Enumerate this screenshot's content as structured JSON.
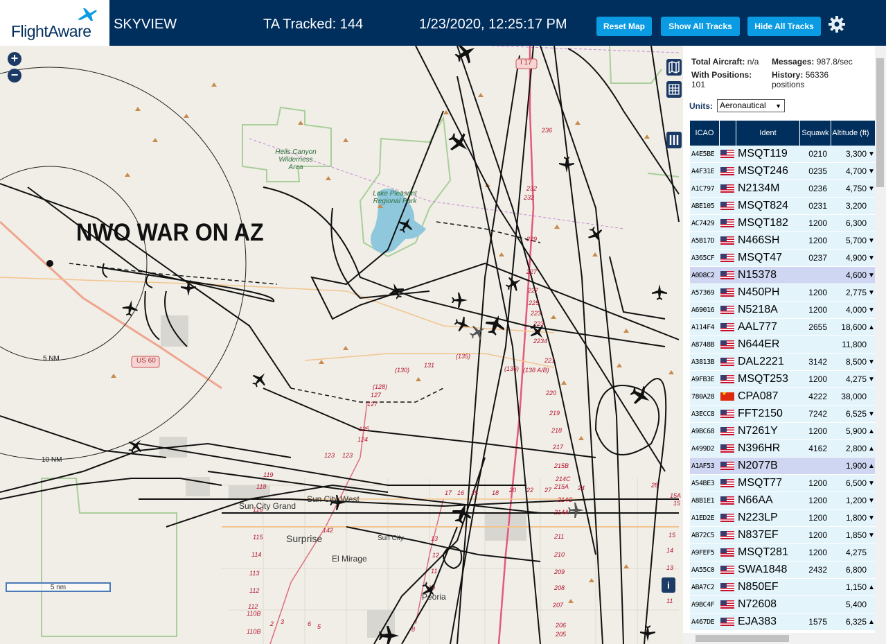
{
  "header": {
    "logo_text": "FlightAware",
    "app_name": "SKYVIEW",
    "tracked": "TA Tracked: 144",
    "datetime": "1/23/2020, 12:25:17 PM",
    "buttons": {
      "reset": "Reset Map",
      "show": "Show All Tracks",
      "hide": "Hide All Tracks"
    }
  },
  "map": {
    "overlay_text": "NWO WAR ON AZ",
    "zoom_in": "+",
    "zoom_out": "−",
    "labels": {
      "hells_canyon": "Hells Canyon Wilderness Area",
      "lake": "Lake Pleasant Regional Park",
      "sun_city_grand": "Sun City Grand",
      "sun_city_west": "Sun City West",
      "sun_city": "Sun City",
      "surprise": "Surprise",
      "el_mirage": "El Mirage",
      "peoria": "Peoria",
      "us60": "US 60",
      "i17": "I 17",
      "ring5": "5 NM",
      "ring10": "10 NM"
    },
    "scale": "5 nm",
    "info": "i"
  },
  "sidebar": {
    "stats": {
      "total_label": "Total Aircraft:",
      "total_value": "n/a",
      "messages_label": "Messages:",
      "messages_value": "987.8/sec",
      "positions_label": "With Positions:",
      "positions_value": "101",
      "history_label": "History:",
      "history_value": "56336 positions"
    },
    "units_label": "Units:",
    "units_value": "Aeronautical",
    "columns": {
      "icao": "ICAO",
      "ident": "Ident",
      "squawk": "Squawk",
      "altitude": "Altitude (ft)"
    },
    "rows": [
      {
        "icao": "A4E5BE",
        "flag": "us",
        "ident": "MSQT119",
        "squawk": "0210",
        "alt": "3,300",
        "arrow": "▼"
      },
      {
        "icao": "A4F31E",
        "flag": "us",
        "ident": "MSQT246",
        "squawk": "0235",
        "alt": "4,700",
        "arrow": "▼"
      },
      {
        "icao": "A1C797",
        "flag": "us",
        "ident": "N2134M",
        "squawk": "0236",
        "alt": "4,750",
        "arrow": "▼"
      },
      {
        "icao": "ABE105",
        "flag": "us",
        "ident": "MSQT824",
        "squawk": "0231",
        "alt": "3,200",
        "arrow": ""
      },
      {
        "icao": "AC7429",
        "flag": "us",
        "ident": "MSQT182",
        "squawk": "1200",
        "alt": "6,300",
        "arrow": ""
      },
      {
        "icao": "A5B17D",
        "flag": "us",
        "ident": "N466SH",
        "squawk": "1200",
        "alt": "5,700",
        "arrow": "▼"
      },
      {
        "icao": "A365CF",
        "flag": "us",
        "ident": "MSQT47",
        "squawk": "0237",
        "alt": "4,900",
        "arrow": "▼"
      },
      {
        "icao": "A0D8C2",
        "flag": "us",
        "ident": "N15378",
        "squawk": "",
        "alt": "4,600",
        "arrow": "▼",
        "sel": true
      },
      {
        "icao": "A57369",
        "flag": "us",
        "ident": "N450PH",
        "squawk": "1200",
        "alt": "2,775",
        "arrow": "▼"
      },
      {
        "icao": "A69016",
        "flag": "us",
        "ident": "N5218A",
        "squawk": "1200",
        "alt": "4,000",
        "arrow": "▼"
      },
      {
        "icao": "A114F4",
        "flag": "us",
        "ident": "AAL777",
        "squawk": "2655",
        "alt": "18,600",
        "arrow": "▲"
      },
      {
        "icao": "A8748B",
        "flag": "us",
        "ident": "N644ER",
        "squawk": "",
        "alt": "11,800",
        "arrow": ""
      },
      {
        "icao": "A3813B",
        "flag": "us",
        "ident": "DAL2221",
        "squawk": "3142",
        "alt": "8,500",
        "arrow": "▼"
      },
      {
        "icao": "A9FB3E",
        "flag": "us",
        "ident": "MSQT253",
        "squawk": "1200",
        "alt": "4,275",
        "arrow": "▼"
      },
      {
        "icao": "780A28",
        "flag": "cn",
        "ident": "CPA087",
        "squawk": "4222",
        "alt": "38,000",
        "arrow": ""
      },
      {
        "icao": "A3ECC8",
        "flag": "us",
        "ident": "FFT2150",
        "squawk": "7242",
        "alt": "6,525",
        "arrow": "▼"
      },
      {
        "icao": "A9BC68",
        "flag": "us",
        "ident": "N7261Y",
        "squawk": "1200",
        "alt": "5,900",
        "arrow": "▲"
      },
      {
        "icao": "A499D2",
        "flag": "us",
        "ident": "N396HR",
        "squawk": "4162",
        "alt": "2,800",
        "arrow": "▲"
      },
      {
        "icao": "A1AF53",
        "flag": "us",
        "ident": "N2077B",
        "squawk": "",
        "alt": "1,900",
        "arrow": "▲",
        "sel": true
      },
      {
        "icao": "A54BE3",
        "flag": "us",
        "ident": "MSQT77",
        "squawk": "1200",
        "alt": "6,500",
        "arrow": "▼"
      },
      {
        "icao": "A8B1E1",
        "flag": "us",
        "ident": "N66AA",
        "squawk": "1200",
        "alt": "1,200",
        "arrow": "▼"
      },
      {
        "icao": "A1ED2E",
        "flag": "us",
        "ident": "N223LP",
        "squawk": "1200",
        "alt": "1,800",
        "arrow": "▼"
      },
      {
        "icao": "AB72C5",
        "flag": "us",
        "ident": "N837EF",
        "squawk": "1200",
        "alt": "1,850",
        "arrow": "▼"
      },
      {
        "icao": "A9FEF5",
        "flag": "us",
        "ident": "MSQT281",
        "squawk": "1200",
        "alt": "4,275",
        "arrow": ""
      },
      {
        "icao": "AA55C0",
        "flag": "us",
        "ident": "SWA1848",
        "squawk": "2432",
        "alt": "6,800",
        "arrow": ""
      },
      {
        "icao": "ABA7C2",
        "flag": "us",
        "ident": "N850EF",
        "squawk": "",
        "alt": "1,150",
        "arrow": "▲"
      },
      {
        "icao": "A9BC4F",
        "flag": "us",
        "ident": "N72608",
        "squawk": "",
        "alt": "5,400",
        "arrow": ""
      },
      {
        "icao": "A467DE",
        "flag": "us",
        "ident": "EJA383",
        "squawk": "1575",
        "alt": "6,325",
        "arrow": "▲"
      }
    ]
  }
}
